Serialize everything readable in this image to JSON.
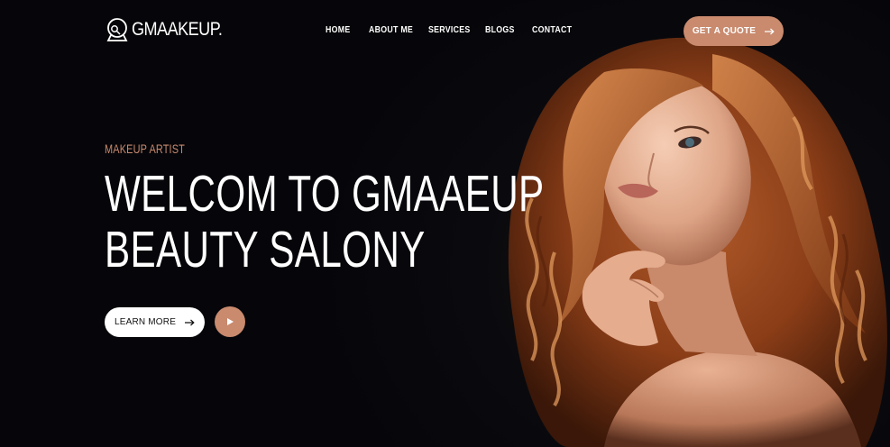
{
  "brand": {
    "name": "GMAAKEUP.",
    "icon": "makeup-mirror-icon"
  },
  "nav": {
    "items": [
      {
        "label": "HOME"
      },
      {
        "label": "ABOUT ME"
      },
      {
        "label": "SERVICES"
      },
      {
        "label": "BLOGS"
      },
      {
        "label": "CONTACT"
      }
    ]
  },
  "header": {
    "cta_label": "GET A QUOTE",
    "cta_icon": "arrow-right-icon"
  },
  "hero": {
    "eyebrow": "MAKEUP ARTIST",
    "title_line1": "WELCOM TO GMAAEUP",
    "title_line2": "BEAUTY SALONY",
    "learn_more_label": "LEARN MORE",
    "learn_more_icon": "arrow-right-icon",
    "play_icon": "play-icon",
    "image": "portrait-photo"
  },
  "colors": {
    "background": "#07070b",
    "accent": "#c98a6e",
    "text": "#ffffff",
    "button_light": "#ffffff"
  }
}
